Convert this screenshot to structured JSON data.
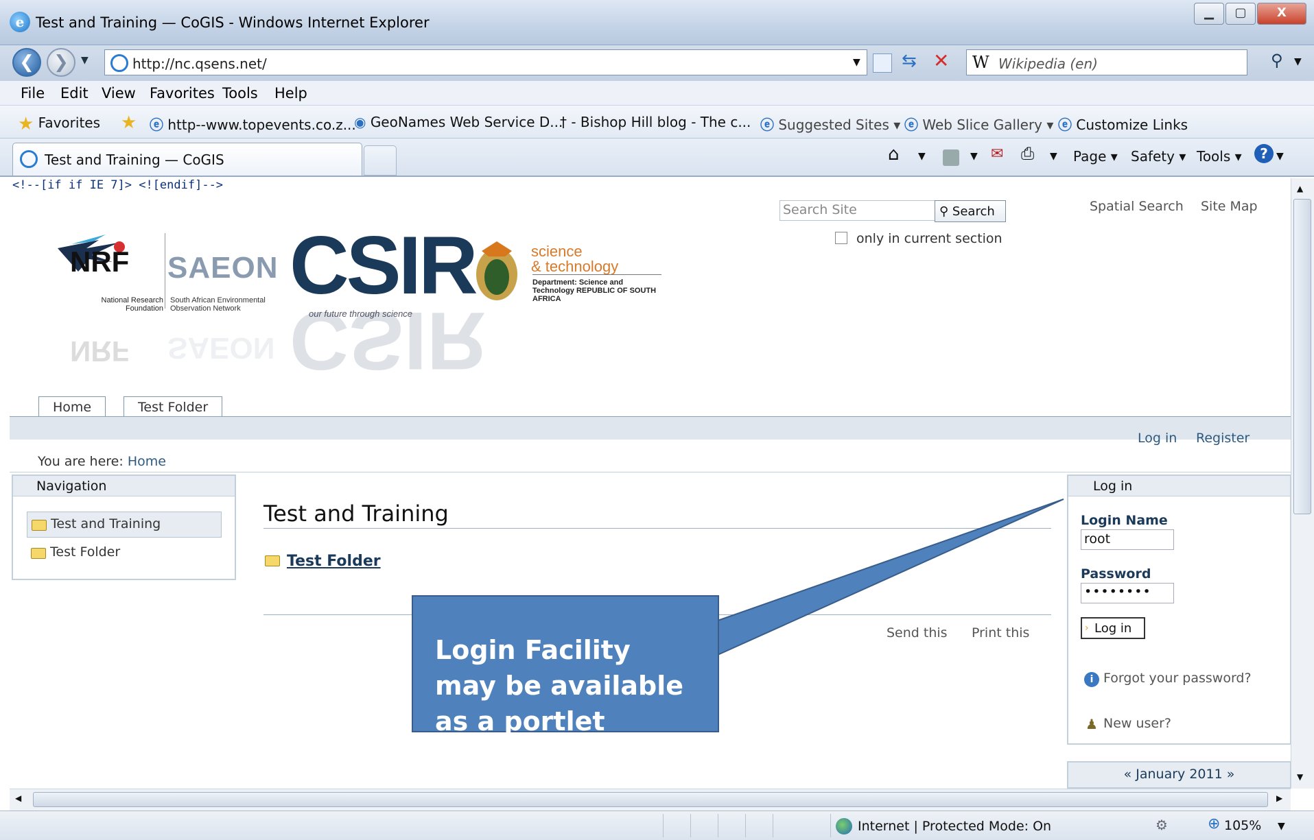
{
  "window": {
    "title": "Test and Training — CoGIS - Windows Internet Explorer",
    "min": "▭",
    "max": "▢",
    "close": "X"
  },
  "address": {
    "url": "http://nc.qsens.net/",
    "search_placeholder": "Wikipedia (en)",
    "search_provider_mark": "W"
  },
  "menu": [
    "File",
    "Edit",
    "View",
    "Favorites",
    "Tools",
    "Help"
  ],
  "favorites": {
    "label": "Favorites",
    "items": [
      "http--www.topevents.co.z...",
      "GeoNames Web Service D...",
      "- Bishop Hill blog - The c...",
      "Suggested Sites ▾",
      "Web Slice Gallery ▾",
      "Customize Links"
    ]
  },
  "tabs": {
    "active": "Test and Training — CoGIS"
  },
  "command_bar": [
    "Page ▾",
    "Safety ▾",
    "Tools ▾"
  ],
  "page": {
    "ie_comment": "<!--[if if IE 7]> <![endif]-->",
    "search_placeholder": "Search Site",
    "search_button": "Search",
    "only_current": "only in current section",
    "spatial_search": "Spatial Search",
    "site_map": "Site Map",
    "logos": {
      "nrf": "NRF",
      "nrf_sub": "National Research Foundation",
      "saeon": "SAEON",
      "saeon_sub": "South African Environmental Observation Network",
      "csir": "CSIR",
      "csir_sub": "our future through science",
      "sci1": "science",
      "sci2": "& technology",
      "dept": "Department: Science and Technology REPUBLIC OF SOUTH AFRICA"
    },
    "tabs": [
      "Home",
      "Test Folder"
    ],
    "login_link": "Log in",
    "register_link": "Register",
    "breadcrumb_prefix": "You are here:",
    "breadcrumb_home": "Home",
    "nav_header": "Navigation",
    "nav_items": [
      "Test and Training",
      "Test Folder"
    ],
    "main_title": "Test and Training",
    "folder_link": "Test Folder",
    "send_this": "Send this",
    "print_this": "Print this",
    "login_portlet": {
      "header": "Log in",
      "name_label": "Login Name",
      "name_value": "root",
      "pwd_label": "Password",
      "pwd_value": "••••••••",
      "button": "Log in",
      "forgot": "Forgot your password?",
      "new_user": "New user?"
    },
    "calendar_header": "« January 2011 »"
  },
  "callout": {
    "text": "Login Facility may be available as a portlet"
  },
  "status": {
    "zone": "Internet | Protected Mode: On",
    "zoom": "105%"
  },
  "colors": {
    "callout": "#4f81bd",
    "link": "#2d5a80"
  }
}
